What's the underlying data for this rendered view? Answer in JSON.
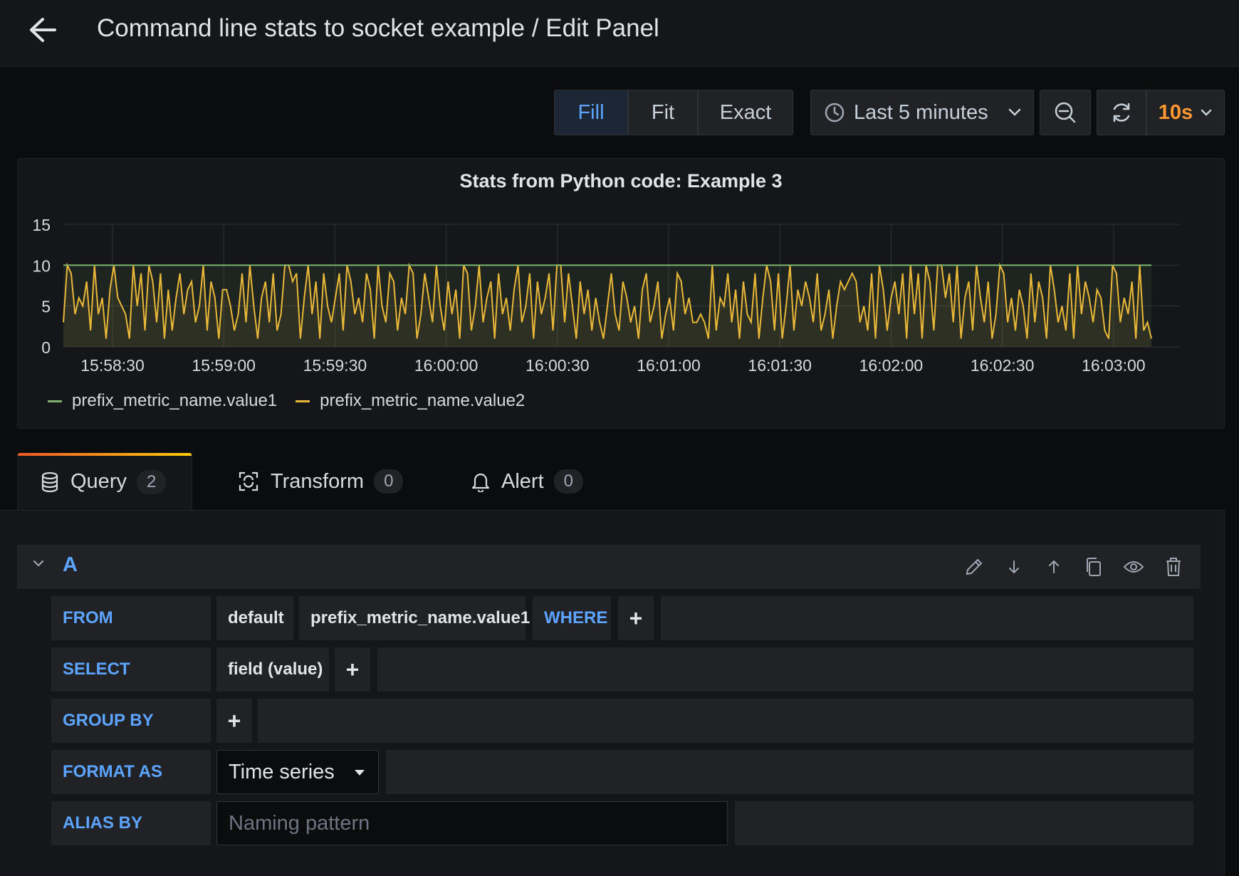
{
  "header": {
    "title": "Command line stats to socket example / Edit Panel"
  },
  "toolbar": {
    "fill_modes": [
      "Fill",
      "Fit",
      "Exact"
    ],
    "active_fill_mode": "Fill",
    "time_range": "Last 5 minutes",
    "refresh_interval": "10s"
  },
  "panel": {
    "title": "Stats from Python code: Example 3"
  },
  "chart_data": {
    "type": "line",
    "title": "Stats from Python code: Example 3",
    "xlabel": "",
    "ylabel": "",
    "ylim": [
      0,
      15
    ],
    "y_ticks": [
      "0",
      "5",
      "10",
      "15"
    ],
    "x_ticks": [
      "15:58:30",
      "15:59:00",
      "15:59:30",
      "16:00:00",
      "16:00:30",
      "16:01:00",
      "16:01:30",
      "16:02:00",
      "16:02:30",
      "16:03:00"
    ],
    "x_range": [
      "15:58:17",
      "15:58:17 to 16:03:09"
    ],
    "grid": true,
    "legend_position": "bottom-left",
    "series": [
      {
        "name": "prefix_metric_name.value1",
        "color": "#7eb26d",
        "constant": 10
      },
      {
        "name": "prefix_metric_name.value2",
        "color": "#eab839",
        "values": [
          3,
          10,
          9,
          4,
          6,
          5,
          8,
          2,
          10,
          4,
          6,
          1,
          7,
          10,
          6,
          5,
          4,
          1,
          10,
          5,
          9,
          2,
          10,
          8,
          3,
          9,
          1,
          7,
          2,
          6,
          9,
          4,
          7,
          8,
          3,
          5,
          10,
          2,
          8,
          6,
          1,
          7,
          7,
          5,
          2,
          4,
          9,
          3,
          10,
          5,
          1,
          6,
          8,
          3,
          9,
          2,
          4,
          10,
          10,
          8,
          9,
          1,
          6,
          10,
          4,
          8,
          1,
          9,
          5,
          3,
          6,
          9,
          2,
          10,
          8,
          4,
          6,
          3,
          9,
          7,
          1,
          10,
          5,
          3,
          9,
          8,
          2,
          6,
          4,
          10,
          9,
          1,
          4,
          9,
          6,
          3,
          10,
          5,
          2,
          8,
          4,
          7,
          1,
          10,
          9,
          2,
          5,
          10,
          3,
          6,
          8,
          1,
          9,
          4,
          6,
          2,
          7,
          10,
          3,
          5,
          9,
          1,
          8,
          4,
          6,
          9,
          2,
          10,
          10,
          3,
          9,
          5,
          1,
          8,
          4,
          7,
          2,
          6,
          3,
          1,
          5,
          9,
          4,
          2,
          8,
          6,
          3,
          5,
          1,
          7,
          9,
          3,
          5,
          8,
          1,
          4,
          6,
          2,
          9,
          8,
          4,
          6,
          3,
          3,
          4,
          3,
          1,
          10,
          2,
          6,
          5,
          9,
          3,
          7,
          1,
          8,
          4,
          3,
          9,
          1,
          6,
          10,
          8,
          2,
          9,
          1,
          5,
          10,
          2,
          7,
          5,
          8,
          6,
          3,
          9,
          2,
          4,
          7,
          1,
          5,
          8,
          7,
          8,
          9,
          8,
          3,
          5,
          2,
          9,
          1,
          10,
          7,
          2,
          6,
          8,
          4,
          9,
          1,
          10,
          4,
          9,
          1,
          10,
          8,
          2,
          10,
          10,
          6,
          9,
          3,
          10,
          1,
          6,
          8,
          2,
          10,
          6,
          3,
          8,
          1,
          4,
          10,
          9,
          3,
          6,
          2,
          7,
          5,
          1,
          9,
          3,
          8,
          6,
          1,
          10,
          7,
          3,
          5,
          2,
          9,
          1,
          10,
          4,
          8,
          6,
          3,
          7,
          6,
          2,
          1,
          10,
          9,
          3,
          6,
          4,
          8,
          1,
          10,
          2,
          3,
          1
        ]
      }
    ]
  },
  "tabs": [
    {
      "label": "Query",
      "count": "2"
    },
    {
      "label": "Transform",
      "count": "0"
    },
    {
      "label": "Alert",
      "count": "0"
    }
  ],
  "query": {
    "ref_id": "A",
    "from_label": "FROM",
    "from_policy": "default",
    "from_measurement": "prefix_metric_name.value1",
    "where_label": "WHERE",
    "select_label": "SELECT",
    "select_field": "field (value)",
    "group_by_label": "GROUP BY",
    "format_as_label": "FORMAT AS",
    "format_as_value": "Time series",
    "alias_by_label": "ALIAS BY",
    "alias_placeholder": "Naming pattern",
    "plus": "+"
  }
}
